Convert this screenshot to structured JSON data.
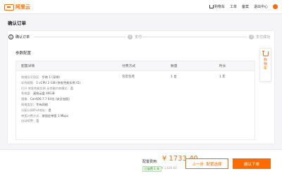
{
  "brand": {
    "logo_text": "阿里云",
    "accent": "#ff6a00"
  },
  "topnav": {
    "cart": "购物车",
    "orders": "工单",
    "filing": "备案",
    "console": "退出中心"
  },
  "page_title": "确认订单",
  "steps": [
    {
      "num": "1",
      "label": "确认订单",
      "state": "current"
    },
    {
      "num": "2",
      "label": "支付",
      "state": "pending"
    },
    {
      "num": "3",
      "label": "支付成功",
      "state": "pending"
    }
  ],
  "section_title": "参数配置",
  "table": {
    "headers": [
      "配置详情",
      "付费方式",
      "数量",
      "时长"
    ],
    "specs": [
      {
        "key": "地域及可用区:",
        "value": "华南 1 (深圳)"
      },
      {
        "key": "实例规格:",
        "value": "1 vCPU 2 GiB (突发性能实例 t5)"
      },
      {
        "key": "打开 突发性能实例 无性能约束模式:",
        "value": "否"
      },
      {
        "key": "系统盘:",
        "value": "高效云盘 40GiB"
      },
      {
        "key": "镜像:",
        "value": "CentOS 7.7 64位 (安全加固)"
      },
      {
        "key": "网络类型:",
        "value": "专有网络"
      },
      {
        "key": "分配公网IPv4地址:",
        "value": "是"
      },
      {
        "key": "带宽计费方式:",
        "value": "按固定带宽 1 Mbps"
      },
      {
        "key": "自动续费:",
        "value": "否"
      }
    ],
    "billing": "包年包月",
    "quantity": "1 台",
    "duration": "1 年"
  },
  "side_cart": {
    "label": "购物车"
  },
  "footer": {
    "price_label": "配置费用:",
    "price": "¥ 1733.40",
    "saving": "已省费 1 年",
    "original_price": "¥ 1,026.60",
    "prev_button": "上一步: 配置选择",
    "next_button": "确认下单"
  }
}
